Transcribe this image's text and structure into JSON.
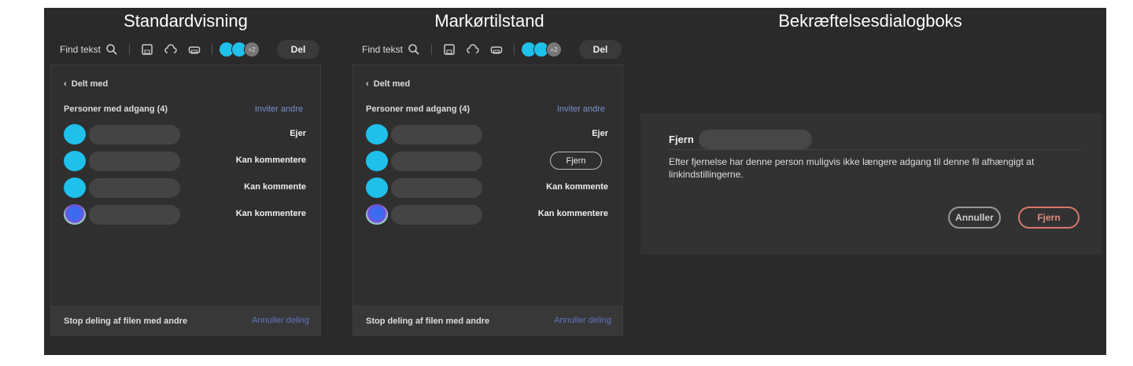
{
  "titles": {
    "standard": "Standardvisning",
    "marker": "Markørtilstand",
    "dialog": "Bekræftelsesdialogboks"
  },
  "toolbar": {
    "find": "Find tekst",
    "more_count": "+2",
    "share": "Del"
  },
  "panel": {
    "back": "Delt med",
    "people": "Personer med adgang (4)",
    "invite": "Inviter andre",
    "stop": "Stop deling af filen med andre",
    "cancel_share": "Annuller deling"
  },
  "standard_rows": [
    {
      "role": "Ejer"
    },
    {
      "role": "Kan kommentere"
    },
    {
      "role": "Kan kommente"
    },
    {
      "role": "Kan kommentere"
    }
  ],
  "marker_rows": [
    {
      "role": "Ejer"
    },
    {
      "role": "Fjern"
    },
    {
      "role": "Kan kommente"
    },
    {
      "role": "Kan kommentere"
    }
  ],
  "dialog": {
    "title": "Fjern",
    "text": "Efter fjernelse har denne person muligvis ikke længere adgang til denne fil afhængigt at linkindstillingerne.",
    "cancel": "Annuller",
    "remove": "Fjern"
  }
}
